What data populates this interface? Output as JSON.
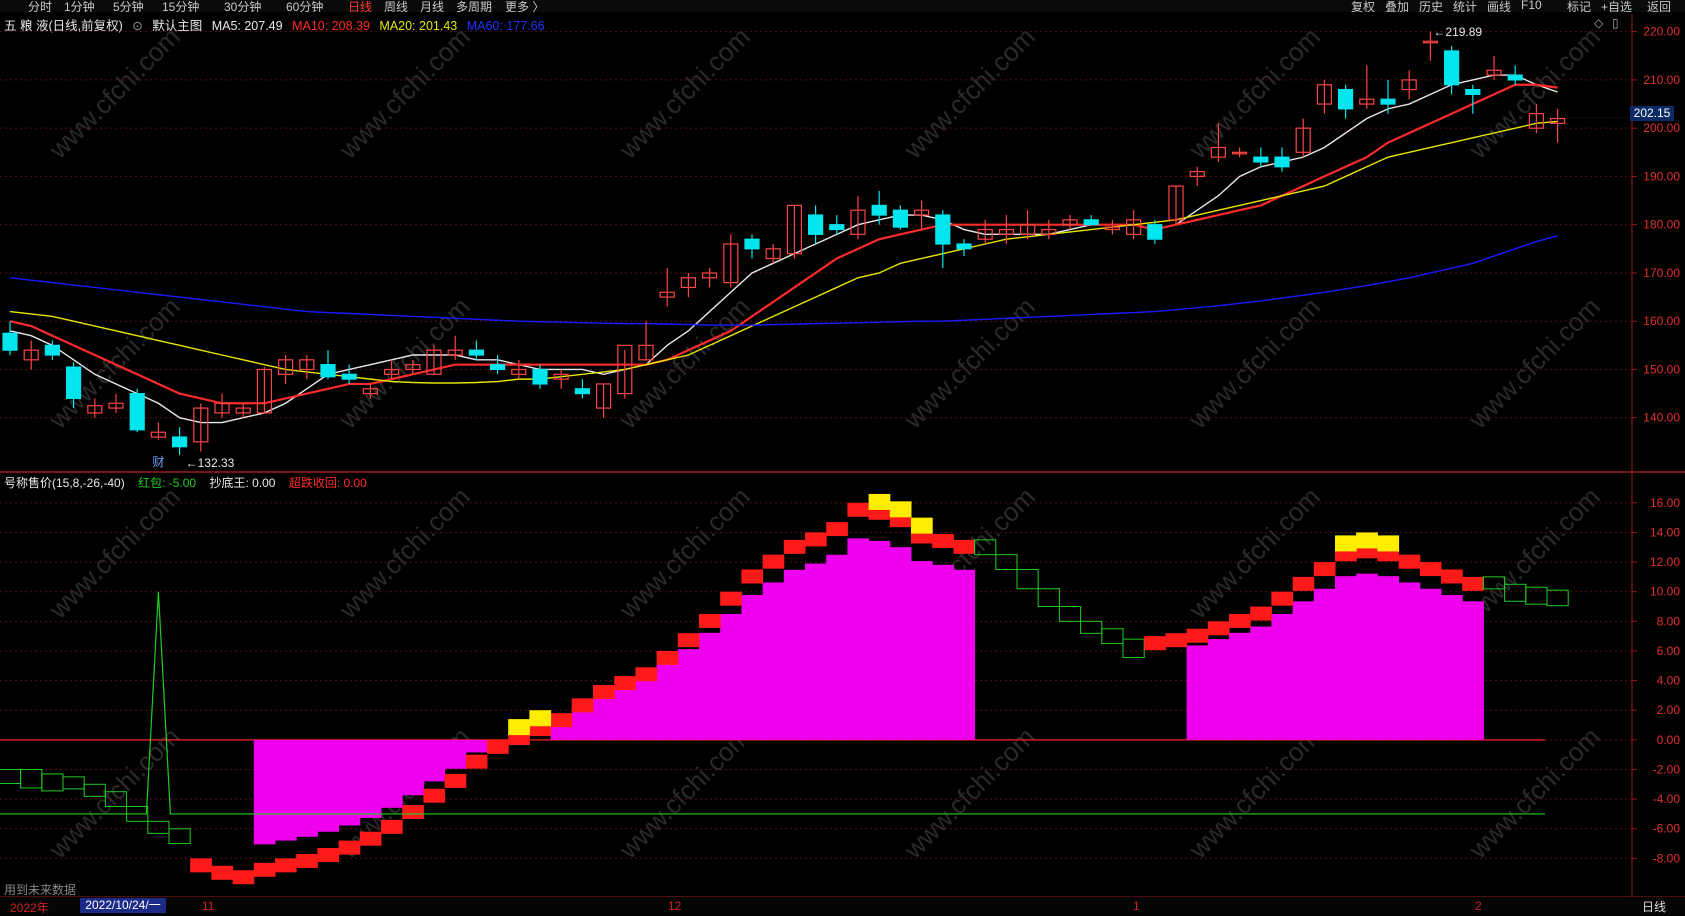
{
  "toolbar": {
    "periods": [
      "分时",
      "1分钟",
      "5分钟",
      "15分钟",
      "30分钟",
      "60分钟",
      "日线",
      "周线",
      "月线",
      "多周期",
      "更多 〉"
    ],
    "active": "日线",
    "right_buttons": [
      "复权",
      "叠加",
      "历史",
      "统计",
      "画线",
      "F10",
      "标记",
      "+自选",
      "返回"
    ]
  },
  "main_header": {
    "stock": "五 粮 液(日线,前复权)",
    "template": "默认主图",
    "ma5": "MA5: 207.49",
    "ma10": "MA10: 208.39",
    "ma20": "MA20: 201.43",
    "ma60": "MA60: 177.66"
  },
  "indicator_header": {
    "name": "号称售价(15,8,-26,-40)",
    "hongbao": "红包: -5.00",
    "chaodi": "抄底王: 0.00",
    "chaodie": "超跌收回: 0.00"
  },
  "price_axis": [
    "220.00",
    "210.00",
    "200.00",
    "190.00",
    "180.00",
    "170.00",
    "160.00",
    "150.00",
    "140.00"
  ],
  "indicator_axis": [
    "16.00",
    "14.00",
    "12.00",
    "10.00",
    "8.00",
    "6.00",
    "4.00",
    "2.00",
    "0.00",
    "-2.00",
    "-4.00",
    "-6.00",
    "-8.00"
  ],
  "current_price": "202.15",
  "annotations": {
    "high": "219.89",
    "low": "132.33",
    "fin_marker": "财"
  },
  "bottom": {
    "year": "2022年",
    "cursor_date": "2022/10/24/一",
    "months": [
      "11",
      "12",
      "1",
      "2"
    ],
    "period": "日线",
    "footnote": "用到未来数据"
  },
  "watermark": "www.cfchi.com",
  "chart_data": [
    {
      "type": "candlestick",
      "title": "五 粮 液(日线,前复权)",
      "ylim": [
        130,
        222
      ],
      "candles_ohlc": [
        [
          157.5,
          160,
          153,
          154
        ],
        [
          152,
          156,
          150,
          154
        ],
        [
          155,
          156,
          152,
          153
        ],
        [
          150.5,
          151.5,
          142,
          144
        ],
        [
          141,
          144,
          140,
          142.5
        ],
        [
          142,
          145,
          141,
          143
        ],
        [
          145,
          146,
          137,
          137.5
        ],
        [
          136,
          139,
          135.5,
          137
        ],
        [
          136,
          138,
          132.3,
          134
        ],
        [
          135,
          143,
          133,
          142
        ],
        [
          141,
          145,
          140,
          143
        ],
        [
          141,
          143,
          140,
          142
        ],
        [
          141,
          150.5,
          141,
          150
        ],
        [
          149,
          153,
          147,
          152
        ],
        [
          150,
          153,
          148,
          152
        ],
        [
          151,
          154,
          148,
          148.5
        ],
        [
          149,
          151,
          147,
          148
        ],
        [
          145,
          147,
          144,
          146
        ],
        [
          149,
          152,
          148,
          150
        ],
        [
          150,
          152,
          149,
          151
        ],
        [
          149,
          155,
          149,
          154
        ],
        [
          153,
          157,
          152,
          154
        ],
        [
          154,
          156,
          152,
          153
        ],
        [
          151,
          153,
          149,
          150
        ],
        [
          149,
          152,
          148,
          150
        ],
        [
          150,
          151,
          146,
          147
        ],
        [
          148,
          150,
          146,
          149
        ],
        [
          146,
          148,
          144,
          145
        ],
        [
          142,
          147,
          140,
          147
        ],
        [
          145,
          154,
          144,
          155
        ],
        [
          152,
          160,
          152,
          155
        ],
        [
          165,
          171,
          163,
          166
        ],
        [
          167,
          170,
          165,
          169
        ],
        [
          169,
          171,
          167,
          170
        ],
        [
          168,
          178,
          167,
          176
        ],
        [
          177,
          178,
          173,
          175
        ],
        [
          173,
          176,
          172,
          175
        ],
        [
          174,
          184,
          173,
          184
        ],
        [
          182,
          184,
          176,
          178
        ],
        [
          180,
          182,
          178,
          179
        ],
        [
          178,
          186,
          177,
          183
        ],
        [
          184,
          187,
          180,
          182
        ],
        [
          183,
          184,
          179,
          179.5
        ],
        [
          182,
          185,
          179,
          183
        ],
        [
          182,
          183,
          171,
          176
        ],
        [
          176,
          177,
          173.5,
          175
        ],
        [
          177,
          181,
          176,
          179
        ],
        [
          178,
          182,
          176,
          179
        ],
        [
          178,
          183,
          177,
          180
        ],
        [
          178,
          181,
          177,
          179
        ],
        [
          180,
          182,
          179,
          181
        ],
        [
          181,
          182,
          180,
          180
        ],
        [
          179,
          181,
          178,
          179.5
        ],
        [
          178,
          183,
          177,
          181
        ],
        [
          180,
          181,
          176,
          177
        ],
        [
          181,
          188,
          180,
          188
        ],
        [
          190,
          192,
          188,
          191
        ],
        [
          194,
          201,
          193,
          196
        ],
        [
          195,
          196,
          194,
          195
        ],
        [
          194,
          196,
          192,
          193
        ],
        [
          194,
          196,
          191,
          192
        ],
        [
          195,
          202,
          194,
          200
        ],
        [
          205,
          210,
          203,
          209
        ],
        [
          208,
          209,
          202,
          204
        ],
        [
          205,
          213,
          204,
          206
        ],
        [
          206,
          210,
          203,
          205
        ],
        [
          208,
          212,
          206,
          210
        ],
        [
          218,
          220,
          214,
          218
        ],
        [
          216,
          217,
          207,
          209
        ],
        [
          208,
          209,
          203,
          207
        ],
        [
          211,
          215,
          210,
          212
        ],
        [
          211,
          213,
          209,
          210
        ],
        [
          200,
          205,
          199,
          203
        ],
        [
          201,
          204,
          197,
          202
        ]
      ],
      "ma_series": [
        {
          "name": "MA5",
          "values": [
            158,
            157,
            155,
            152,
            149,
            147,
            145,
            143,
            140,
            139,
            139,
            140,
            141,
            143,
            146,
            149,
            150,
            151,
            152,
            153,
            153,
            153,
            152,
            152,
            151,
            150,
            150,
            150,
            149,
            150,
            151,
            155,
            158,
            162,
            166,
            170,
            172,
            174,
            176,
            178,
            180,
            181,
            182,
            182,
            181,
            179,
            178,
            178,
            178,
            178,
            179,
            180,
            180,
            180,
            179,
            180,
            183,
            186,
            190,
            192,
            193,
            194,
            196,
            199,
            202,
            204,
            205,
            207,
            209,
            210,
            211,
            211,
            209,
            207.5
          ]
        },
        {
          "name": "MA10",
          "values": [
            160,
            159,
            157,
            155,
            153,
            151,
            149,
            147,
            145,
            144,
            143,
            143,
            143,
            144,
            145,
            146,
            147,
            147,
            148,
            149,
            150,
            151,
            151,
            151,
            151,
            151,
            151,
            151,
            151,
            151,
            151,
            152,
            154,
            156,
            158,
            161,
            164,
            167,
            170,
            173,
            175,
            177,
            178,
            179,
            180,
            180,
            180,
            180,
            180,
            180,
            180,
            180,
            180,
            180,
            179,
            180,
            181,
            182,
            183,
            184,
            186,
            188,
            190,
            192,
            194,
            197,
            199,
            201,
            203,
            205,
            207,
            209,
            209,
            208.4
          ]
        },
        {
          "name": "MA20",
          "values": [
            162,
            161.5,
            161,
            160,
            159,
            158,
            157,
            156,
            155,
            154,
            153,
            152,
            151,
            150,
            149.5,
            149,
            148.5,
            148,
            147.5,
            147.3,
            147.2,
            147.2,
            147.3,
            147.5,
            148,
            148,
            148.5,
            149,
            149.5,
            150,
            151,
            152,
            153,
            155,
            157,
            159,
            161,
            163,
            165,
            167,
            169,
            170,
            172,
            173,
            174,
            175,
            176,
            177,
            177.5,
            178,
            178.5,
            179,
            179.5,
            180,
            180.5,
            181,
            182,
            183,
            184,
            185,
            186,
            187,
            188,
            190,
            192,
            194,
            195,
            196,
            197,
            198,
            199,
            200,
            201,
            201.4
          ]
        },
        {
          "name": "MA60",
          "values": [
            169,
            168.5,
            168,
            167.5,
            167,
            166.5,
            166,
            165.5,
            165,
            164.5,
            164,
            163.5,
            163,
            162.5,
            162,
            161.8,
            161.6,
            161.4,
            161.2,
            161,
            160.8,
            160.6,
            160.4,
            160.2,
            160,
            159.9,
            159.8,
            159.7,
            159.6,
            159.5,
            159.5,
            159.4,
            159.3,
            159.2,
            159.2,
            159.2,
            159.3,
            159.4,
            159.5,
            159.6,
            159.7,
            159.8,
            159.9,
            160,
            160,
            160.2,
            160.4,
            160.6,
            160.8,
            161,
            161.2,
            161.4,
            161.6,
            161.8,
            162,
            162.4,
            162.8,
            163.2,
            163.7,
            164.2,
            164.8,
            165.4,
            166,
            166.7,
            167.4,
            168.2,
            169,
            170,
            171,
            172,
            173.5,
            175,
            176.5,
            177.7
          ]
        }
      ],
      "colors": {
        "up": "#ff4444",
        "down": "#00e5ee",
        "MA5": "#e8e8e8",
        "MA10": "#ff2a2a",
        "MA20": "#e6e600",
        "MA60": "#1a1aff"
      }
    },
    {
      "type": "bar",
      "title": "号称售价(15,8,-26,-40)",
      "ylim": [
        -10,
        17
      ],
      "values": [
        -2,
        -2.3,
        -2.5,
        -3,
        -3.5,
        -4.5,
        -5.5,
        -6,
        -7,
        -8,
        -8.5,
        -8.8,
        -8.3,
        -8,
        -7.7,
        -7.3,
        -6.8,
        -6.2,
        -5.4,
        -4.4,
        -3.3,
        -2.3,
        -1,
        0,
        0.6,
        1.2,
        1.8,
        2.8,
        3.7,
        4.3,
        4.9,
        6,
        7.2,
        8.5,
        10,
        11.5,
        12.5,
        13.5,
        14,
        14.7,
        16,
        15.8,
        15.3,
        14.2,
        13.9,
        13.5,
        12.5,
        11.5,
        10.2,
        9,
        8,
        7.5,
        6.5,
        6.8,
        7,
        7.2,
        7.5,
        8,
        8.5,
        9,
        10,
        11,
        12,
        13,
        13.2,
        13,
        12.5,
        12,
        11.5,
        11,
        10.5,
        10.3,
        10.1,
        10
      ],
      "green_line_levels": [
        -5,
        10,
        -5
      ],
      "colors": {
        "pos_red": "#ff1a1a",
        "magenta": "#ee00ee",
        "yellow": "#ffee00",
        "green": "#22cc22"
      }
    }
  ]
}
